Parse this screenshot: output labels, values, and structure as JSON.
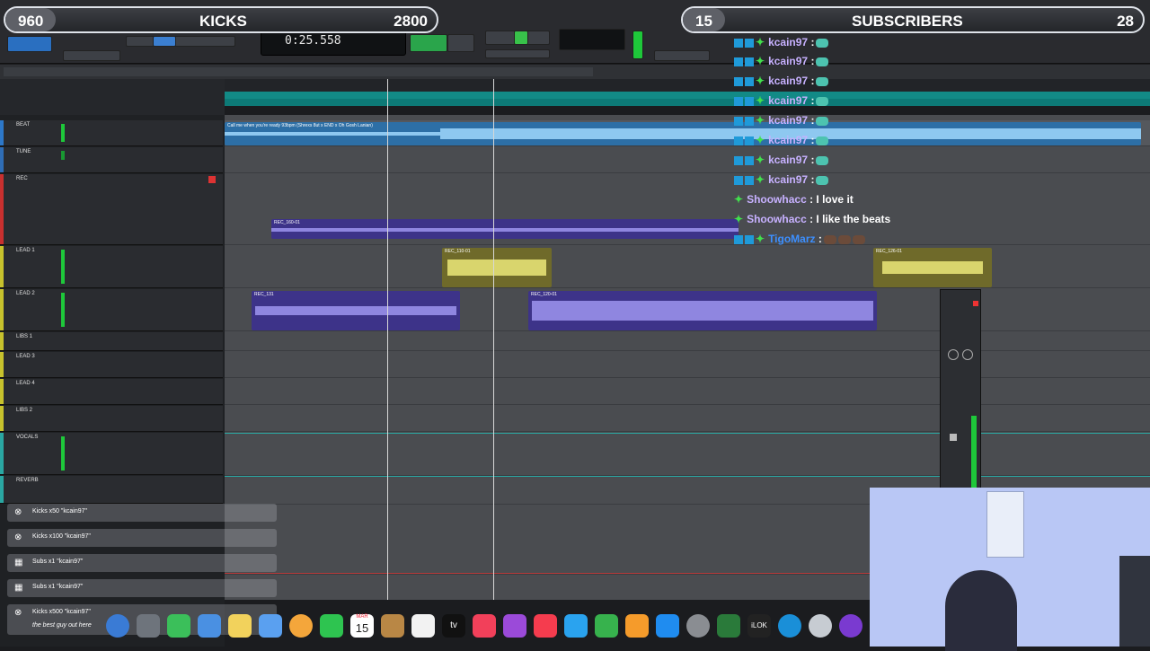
{
  "stats": {
    "kicks_left": "960",
    "kicks_label": "KICKS",
    "kicks_right": "2800",
    "subs_left": "15",
    "subs_label": "SUBSCRIBERS",
    "subs_right": "28"
  },
  "transport": {
    "counter": "0:25.558"
  },
  "tracks": [
    {
      "name": "BEAT",
      "color": "#2d78c9"
    },
    {
      "name": "TUNE",
      "color": "#2f6db5"
    },
    {
      "name": "REC",
      "color": "#c8302f"
    },
    {
      "name": "LEAD 1",
      "color": "#c7c22d"
    },
    {
      "name": "LEAD 2",
      "color": "#c7c22d"
    },
    {
      "name": "LIBS 1",
      "color": "#c7c22d"
    },
    {
      "name": "LEAD 3",
      "color": "#c7c22d"
    },
    {
      "name": "LEAD 4",
      "color": "#c7c22d"
    },
    {
      "name": "LIBS 2",
      "color": "#c7c22d"
    },
    {
      "name": "VOCALS",
      "color": "#2aa7a2"
    },
    {
      "name": "REVERB",
      "color": "#2aa7a2"
    }
  ],
  "clips": {
    "beat": "Call me when you're ready 93bpm (Shrexs 8ut x END x Oh Gosh Lanian)",
    "rec": "REC_160-01",
    "lead1_a": "REC_110-01",
    "lead1_b": "REC_126-01",
    "lead2_a": "REC_131",
    "lead2_b": "REC_120-01"
  },
  "chat": [
    {
      "user": "kcain97",
      "sep": " :",
      "message": "",
      "emote": true
    },
    {
      "user": "kcain97",
      "sep": " :",
      "message": "",
      "emote": true
    },
    {
      "user": "kcain97",
      "sep": " :",
      "message": "",
      "emote": true
    },
    {
      "user": "kcain97",
      "sep": " :",
      "message": "",
      "emote": true
    },
    {
      "user": "kcain97",
      "sep": " :",
      "message": "",
      "emote": true
    },
    {
      "user": "kcain97",
      "sep": " :",
      "message": "",
      "emote": true
    },
    {
      "user": "kcain97",
      "sep": " :",
      "message": "",
      "emote": true
    },
    {
      "user": "kcain97",
      "sep": " :",
      "message": "",
      "emote": true
    },
    {
      "user": "Shoowhacc",
      "sep": " :",
      "message": " I love it",
      "emote": false
    },
    {
      "user": "Shoowhacc",
      "sep": " :",
      "message": " I like the beats",
      "emote": false
    },
    {
      "user": "TigoMarz",
      "sep": " :",
      "message": "",
      "emote": true
    }
  ],
  "notifications": [
    {
      "text": "Kicks x50 \"kcain97\"",
      "icon": "x-icon"
    },
    {
      "text": "Kicks x100 \"kcain97\"",
      "icon": "x-icon"
    },
    {
      "text": "Subs x1 \"kcain97\"",
      "icon": "gift-icon"
    },
    {
      "text": "Subs x1 \"kcain97\"",
      "icon": "gift-icon"
    },
    {
      "text": "Kicks x500 \"kcain97\"",
      "icon": "x-icon"
    }
  ],
  "notif_footer": "the best guy out here",
  "dock": {
    "calendar_month": "MAR",
    "calendar_day": "15",
    "tv_label": "tv",
    "ilok_label": "iLOK"
  }
}
